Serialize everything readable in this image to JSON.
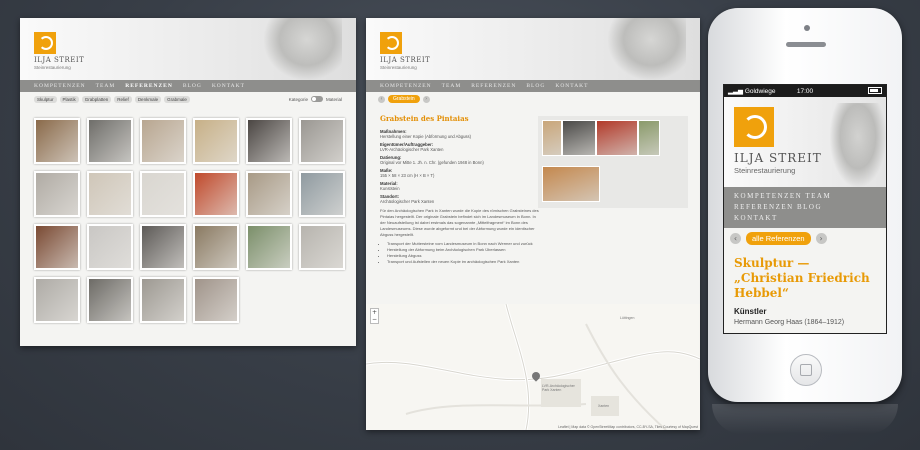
{
  "site": {
    "logo_name": "ILJA STREIT",
    "logo_sub": "Steinrestaurierung"
  },
  "desktop_left": {
    "nav": [
      "KOMPETENZEN",
      "TEAM",
      "REFERENZEN",
      "BLOG",
      "KONTAKT"
    ],
    "active_nav": "REFERENZEN",
    "filters": [
      "Skulptur",
      "Plastik",
      "Grabplatten",
      "Relief",
      "Denkmale",
      "Grabmale"
    ],
    "toggle_left": "Kategorie",
    "toggle_right": "Material",
    "thumb_colors": [
      "#8a6a4a",
      "#6f6e6a",
      "#b8a690",
      "#c7b087",
      "#4b4643",
      "#9a9792",
      "#b0aba4",
      "#cfc6b8",
      "#d9d6d0",
      "#c04a2c",
      "#a89a86",
      "#8f9aa0",
      "#7a4a33",
      "#c9c7c4",
      "#5d5a57",
      "#8a7a62",
      "#7b8f6a",
      "#b7b4ae",
      "#aeaba6",
      "#6d6b66",
      "#9d9992",
      "#a0948a"
    ]
  },
  "desktop_right": {
    "nav": [
      "KOMPETENZEN",
      "TEAM",
      "REFERENZEN",
      "BLOG",
      "KONTAKT"
    ],
    "back_pill": "Grabstein",
    "title": "Grabstein des Pintaias",
    "fields": [
      {
        "label": "Maßnahmen:",
        "value": "Herstellung einer Kopie (Abformung und Abguss)"
      },
      {
        "label": "Eigentümer/Auftraggeber:",
        "value": "LVR-Archäologischer Park Xanten"
      },
      {
        "label": "Datierung:",
        "value": "Original vor Mitte 1. Jh. n. Chr. (gefunden 1948 in Bonn)"
      },
      {
        "label": "Maße:",
        "value": "155 × 58 × 23 cm (H × B × T)"
      },
      {
        "label": "Material:",
        "value": "Kunststein"
      },
      {
        "label": "Standort:",
        "value": "Archäologischer Park Xanten"
      }
    ],
    "body": "Für den Archäologischen Park in Xanten wurde die Kopie des römischen Grabsteines des Pintaias hergestellt. Der originale Grabstein befindet sich im Landesmuseum in Bonn. In der Neuaufstellung ist dabei erstmals das sogenannte „Mittelfragment“ im Bonn des Landesmuseums. Diese wurde abgeformt und bei der Abformung wurde ein identischer Abguss hergestellt.",
    "bullets": [
      "Transport der Muttersteine vom Landesmuseum in Bonn nach Wermer und zurück",
      "Herstellung der Abformung beim Archäologischen Park Überlassen",
      "Herstellung Abguss",
      "Transport und Aufstellen der neuen Kopie im archäologischen Park Xanten"
    ],
    "gallery_colors": [
      "#c9a67a",
      "#4b4a48",
      "#b23a2a",
      "#8a9a6a",
      "#c4884e"
    ],
    "map_zoom_in": "+",
    "map_zoom_out": "−",
    "map_labels": [
      "LVR-Archäologischer Park Xanten",
      "Xanten",
      "Lüttingen"
    ],
    "map_attribution": "Leaflet | Map data © OpenStreetMap contributors, CC-BY-SA, Tiles Courtesy of MapQuest"
  },
  "phone": {
    "status_carrier": "Goldwiege",
    "status_time": "17:00",
    "nav": [
      "KOMPETENZEN TEAM",
      "REFERENZEN BLOG",
      "KONTAKT"
    ],
    "back_pill": "alle Referenzen",
    "title": "Skulptur — „Christian Friedrich Hebbel“",
    "label": "Künstler",
    "value": "Hermann Georg Haas (1864–1912)"
  },
  "colors": {
    "accent": "#f0a10c",
    "nav_bg": "#8e8e8c",
    "page_bg": "#383e47"
  }
}
